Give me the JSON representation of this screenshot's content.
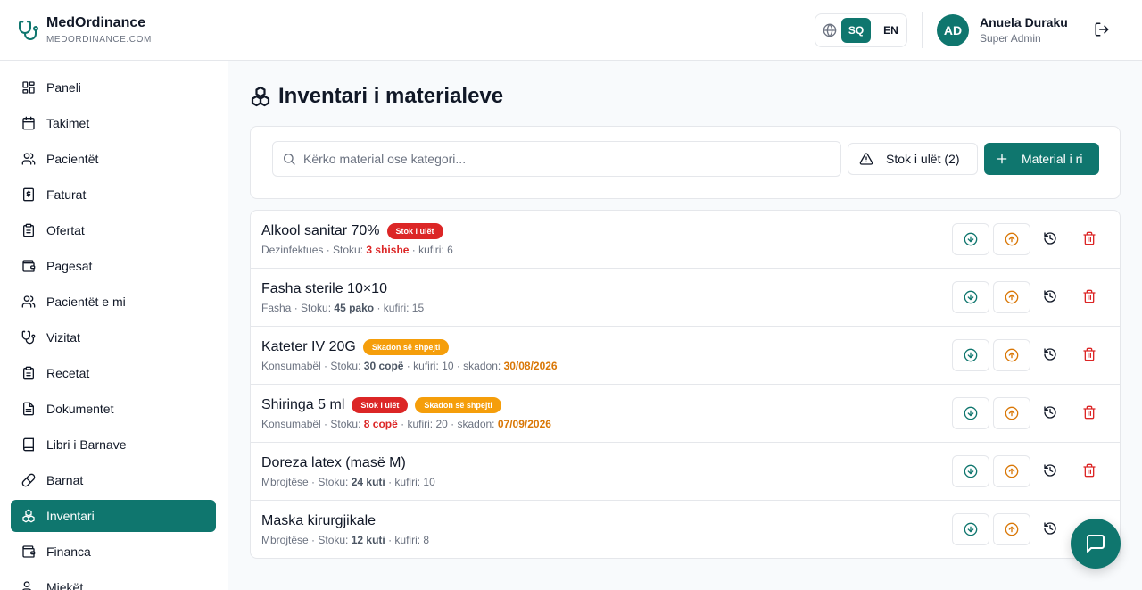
{
  "brand": {
    "name": "MedOrdinance",
    "domain": "MEDORDINANCE.COM",
    "icon": "stethoscope-icon"
  },
  "colors": {
    "primary": "#0f766e",
    "danger": "#dc2626",
    "warning": "#f59e0b",
    "warning_text": "#d97706"
  },
  "sidebar": {
    "items": [
      {
        "label": "Paneli",
        "icon": "dashboard-icon"
      },
      {
        "label": "Takimet",
        "icon": "calendar-icon"
      },
      {
        "label": "Pacientët",
        "icon": "users-icon"
      },
      {
        "label": "Faturat",
        "icon": "invoice-icon"
      },
      {
        "label": "Ofertat",
        "icon": "clipboard-icon"
      },
      {
        "label": "Pagesat",
        "icon": "wallet-icon"
      },
      {
        "label": "Pacientët e mi",
        "icon": "users-icon"
      },
      {
        "label": "Vizitat",
        "icon": "stethoscope-icon"
      },
      {
        "label": "Recetat",
        "icon": "clipboard-icon"
      },
      {
        "label": "Dokumentet",
        "icon": "document-icon"
      },
      {
        "label": "Libri i Barnave",
        "icon": "book-icon"
      },
      {
        "label": "Barnat",
        "icon": "pill-icon"
      },
      {
        "label": "Inventari",
        "icon": "boxes-icon",
        "active": true
      },
      {
        "label": "Financa",
        "icon": "wallet-icon"
      },
      {
        "label": "Miekët",
        "icon": "users-icon"
      }
    ]
  },
  "header": {
    "languages": [
      "SQ",
      "EN"
    ],
    "active_language": "SQ",
    "user": {
      "initials": "AD",
      "name": "Anuela Duraku",
      "role": "Super Admin"
    }
  },
  "page": {
    "title": "Inventari i materialeve",
    "icon": "boxes-icon"
  },
  "toolbar": {
    "search_placeholder": "Kërko material ose kategori...",
    "low_stock_label": "Stok i ulët (2)",
    "new_material_label": "Material i ri"
  },
  "items": [
    {
      "name": "Alkool sanitar 70%",
      "badges": [
        {
          "text": "Stok i ulët",
          "type": "low"
        }
      ],
      "category": "Dezinfektues",
      "stock_prefix": "Stoku:",
      "stock": "3 shishe",
      "stock_state": "low",
      "threshold": "kufiri: 6",
      "expiry_label": "",
      "expiry": ""
    },
    {
      "name": "Fasha sterile 10×10",
      "badges": [],
      "category": "Fasha",
      "stock_prefix": "Stoku:",
      "stock": "45 pako",
      "stock_state": "normal",
      "threshold": "kufiri: 15",
      "expiry_label": "",
      "expiry": ""
    },
    {
      "name": "Kateter IV 20G",
      "badges": [
        {
          "text": "Skadon së shpejti",
          "type": "exp"
        }
      ],
      "category": "Konsumabël",
      "stock_prefix": "Stoku:",
      "stock": "30 copë",
      "stock_state": "normal",
      "threshold": "kufiri: 10",
      "expiry_label": "skadon:",
      "expiry": "30/08/2026"
    },
    {
      "name": "Shiringa 5 ml",
      "badges": [
        {
          "text": "Stok i ulët",
          "type": "low"
        },
        {
          "text": "Skadon së shpejti",
          "type": "exp"
        }
      ],
      "category": "Konsumabël",
      "stock_prefix": "Stoku:",
      "stock": "8 copë",
      "stock_state": "low",
      "threshold": "kufiri: 20",
      "expiry_label": "skadon:",
      "expiry": "07/09/2026"
    },
    {
      "name": "Doreza latex (masë M)",
      "badges": [],
      "category": "Mbrojtëse",
      "stock_prefix": "Stoku:",
      "stock": "24 kuti",
      "stock_state": "normal",
      "threshold": "kufiri: 10",
      "expiry_label": "",
      "expiry": ""
    },
    {
      "name": "Maska kirurgjikale",
      "badges": [],
      "category": "Mbrojtëse",
      "stock_prefix": "Stoku:",
      "stock": "12 kuti",
      "stock_state": "normal",
      "threshold": "kufiri: 8",
      "expiry_label": "",
      "expiry": ""
    }
  ]
}
